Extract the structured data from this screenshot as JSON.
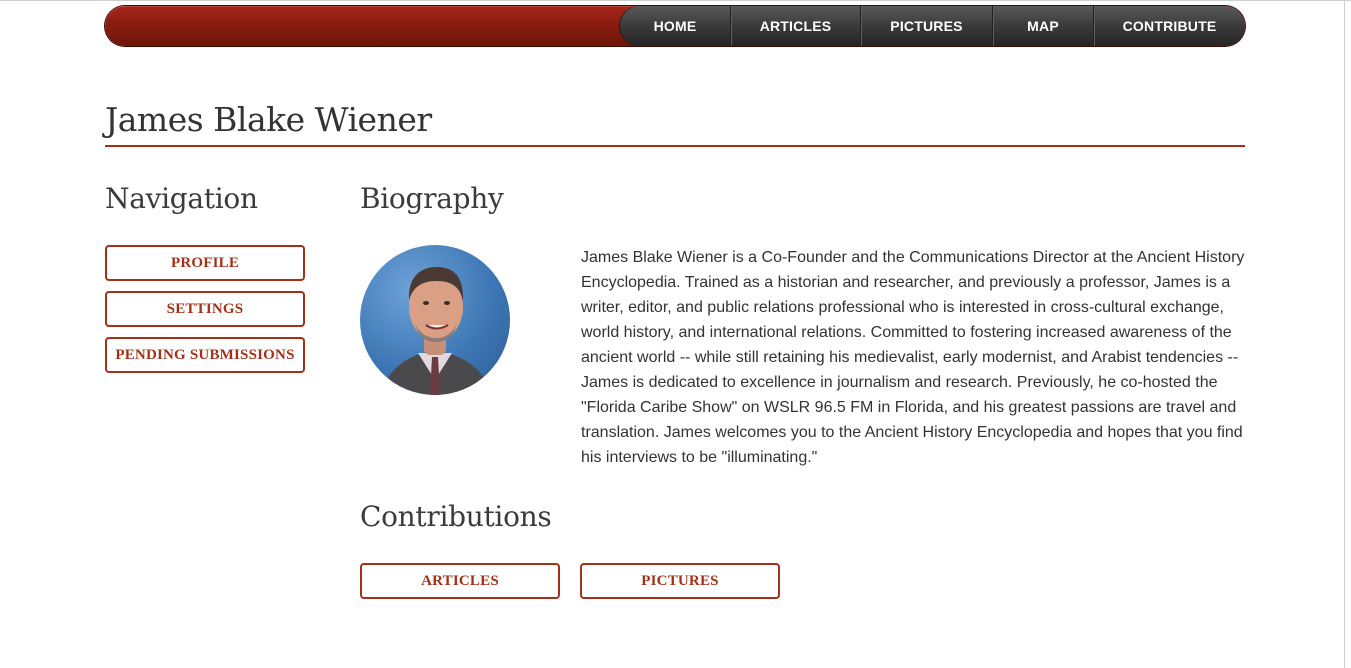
{
  "nav": {
    "items": [
      "HOME",
      "ARTICLES",
      "PICTURES",
      "MAP",
      "CONTRIBUTE"
    ]
  },
  "profile": {
    "name": "James Blake Wiener"
  },
  "sidebar": {
    "heading": "Navigation",
    "buttons": [
      "PROFILE",
      "SETTINGS",
      "PENDING SUBMISSIONS"
    ]
  },
  "biography": {
    "heading": "Biography",
    "text": "James Blake Wiener is a Co-Founder and the Communications Director at the Ancient History Encyclopedia. Trained as a historian and researcher, and previously a professor, James is a writer, editor, and public relations professional who is interested in cross-cultural exchange, world history, and international relations. Committed to fostering increased awareness of the ancient world -- while still retaining his medievalist, early modernist, and Arabist tendencies -- James is dedicated to excellence in journalism and research. Previously, he co-hosted the \"Florida Caribe Show\" on WSLR 96.5 FM in Florida, and his greatest passions are travel and translation. James welcomes you to the Ancient History Encyclopedia and hopes that you find his interviews to be \"illuminating.\""
  },
  "contributions": {
    "heading": "Contributions",
    "buttons": [
      "ARTICLES",
      "PICTURES"
    ]
  },
  "colors": {
    "accent": "#a2311a",
    "navbar_red": "#8a1d10",
    "menu_dark": "#3a3a3a",
    "text": "#333333"
  }
}
